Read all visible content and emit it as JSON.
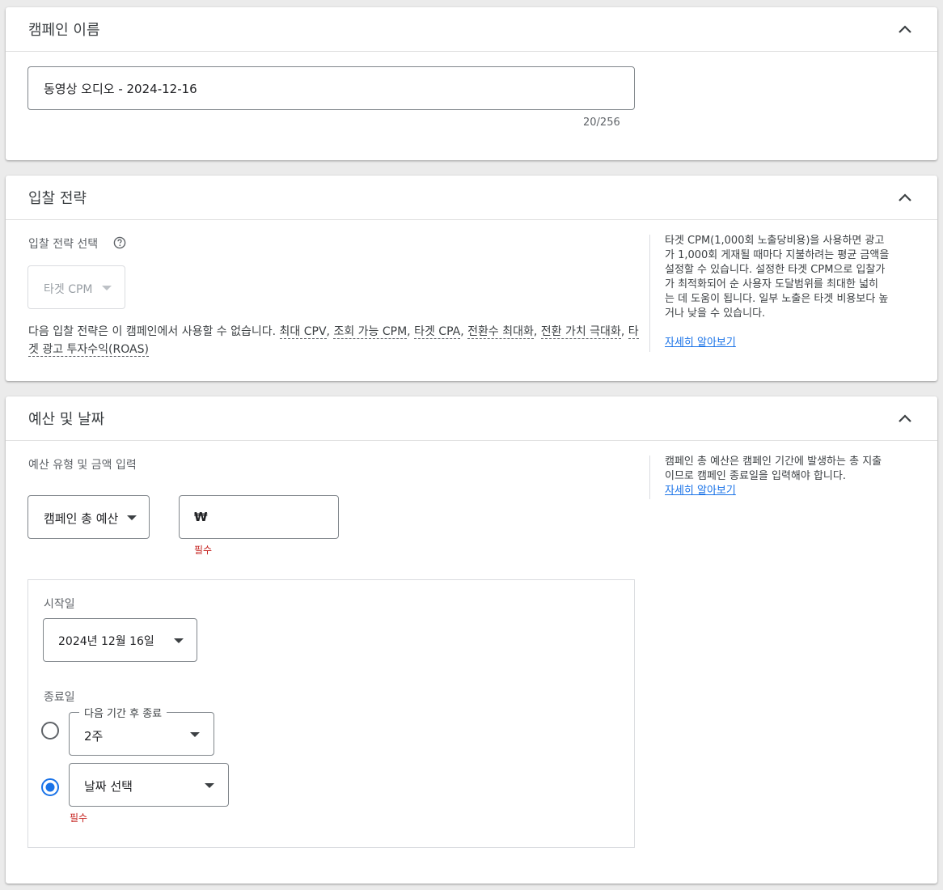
{
  "campaign_name": {
    "title": "캠페인 이름",
    "value": "동영상 오디오 - 2024-12-16",
    "counter": "20/256"
  },
  "bidding": {
    "title": "입찰 전략",
    "select_label": "입찰 전략 선택",
    "selected": "타겟 CPM",
    "unavailable_prefix": "다음 입찰 전략은 이 캠페인에서 사용할 수 없습니다. ",
    "unavailable_items": [
      "최대 CPV",
      "조회 가능 CPM",
      "타겟 CPA",
      "전환수 최대화",
      "전환 가치 극대화",
      "타겟 광고 투자수익(ROAS)"
    ],
    "help_lines": [
      "타겟 CPM(1,000회 노출당비용)을 사용하면 광고",
      "가 1,000회 게재될 때마다 지불하려는 평균 금액을",
      "설정할 수 있습니다. 설정한 타겟 CPM으로 입찰가",
      "가 최적화되어 순 사용자 도달범위를 최대한 넓히",
      "는 데 도움이 됩니다. 일부 노출은 타겟 비용보다 높",
      "거나 낮을 수 있습니다."
    ],
    "learn_more": "자세히 알아보기"
  },
  "budget": {
    "title": "예산 및 날짜",
    "type_label": "예산 유형 및 금액 입력",
    "type_value": "캠페인 총 예산",
    "currency": "₩",
    "required": "필수",
    "start_label": "시작일",
    "start_value": "2024년 12월 16일",
    "end_label": "종료일",
    "end_after_label": "다음 기간 후 종료",
    "end_after_value": "2주",
    "end_date_value": "날짜 선택",
    "end_required": "필수",
    "help_lines": [
      "캠페인 총 예산은 캠페인 기간에 발생하는 총 지출",
      "이므로 캠페인 종료일을 입력해야 합니다."
    ],
    "learn_more": "자세히 알아보기"
  },
  "colors": {
    "accent": "#1a73e8",
    "error": "#c5221f",
    "border": "#80868b"
  }
}
